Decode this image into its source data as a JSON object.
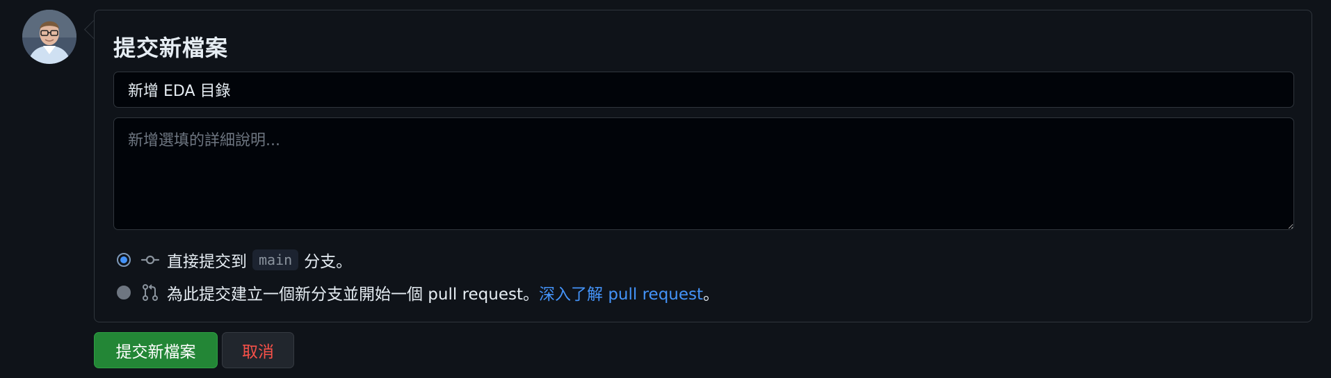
{
  "avatar": {
    "alt": "user avatar"
  },
  "commit_dialog": {
    "title": "提交新檔案",
    "summary_value": "新增 EDA 目錄",
    "description_placeholder": "新增選填的詳細說明...",
    "options": [
      {
        "checked": true,
        "icon": "git-commit-icon",
        "text_before": "直接提交到",
        "branch": "main",
        "text_after": "分支。"
      },
      {
        "checked": false,
        "icon": "git-pull-request-icon",
        "text": "為此提交建立一個新分支並開始一個 pull request。",
        "link_text": "深入了解 pull request",
        "text_after": "。"
      }
    ]
  },
  "buttons": {
    "commit_label": "提交新檔案",
    "cancel_label": "取消"
  },
  "colors": {
    "background": "#0f1319",
    "border": "#30363d",
    "primary_button": "#238636",
    "cancel_text": "#f85149",
    "link": "#4493f8"
  }
}
